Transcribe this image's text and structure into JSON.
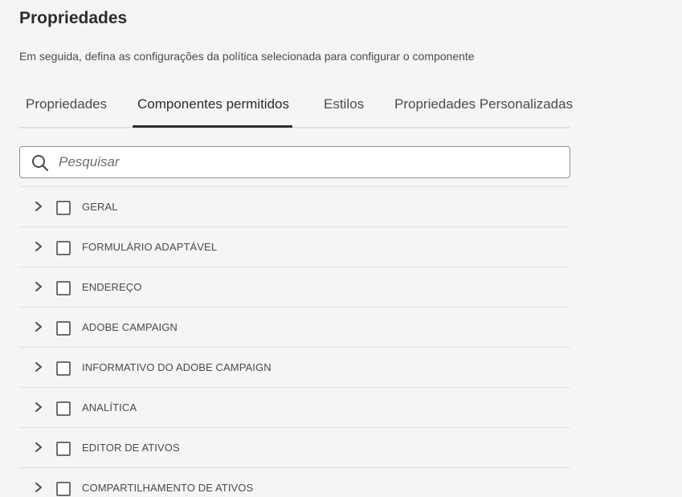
{
  "header": {
    "title": "Propriedades",
    "subtitle": "Em seguida, defina as configurações da política selecionada para configurar o componente"
  },
  "tabs": [
    {
      "label": "Propriedades",
      "active": false
    },
    {
      "label": "Componentes permitidos",
      "active": true
    },
    {
      "label": "Estilos",
      "active": false
    },
    {
      "label": "Propriedades Personalizadas",
      "active": false
    }
  ],
  "search": {
    "placeholder": "Pesquisar",
    "value": "",
    "icon": "search-icon"
  },
  "groups": [
    {
      "label": "GERAL",
      "checked": false,
      "expanded": false
    },
    {
      "label": "FORMULÁRIO ADAPTÁVEL",
      "checked": false,
      "expanded": false
    },
    {
      "label": "ENDEREÇO",
      "checked": false,
      "expanded": false
    },
    {
      "label": "ADOBE CAMPAIGN",
      "checked": false,
      "expanded": false
    },
    {
      "label": "INFORMATIVO DO ADOBE CAMPAIGN",
      "checked": false,
      "expanded": false
    },
    {
      "label": "ANALÍTICA",
      "checked": false,
      "expanded": false
    },
    {
      "label": "EDITOR DE ATIVOS",
      "checked": false,
      "expanded": false
    },
    {
      "label": "COMPARTILHAMENTO DE ATIVOS",
      "checked": false,
      "expanded": false
    }
  ],
  "colors": {
    "background": "#f5f5f5",
    "text": "#2c2c2c",
    "active_tab_indicator": "#2c2c2c",
    "divider": "#e1e1e1"
  }
}
